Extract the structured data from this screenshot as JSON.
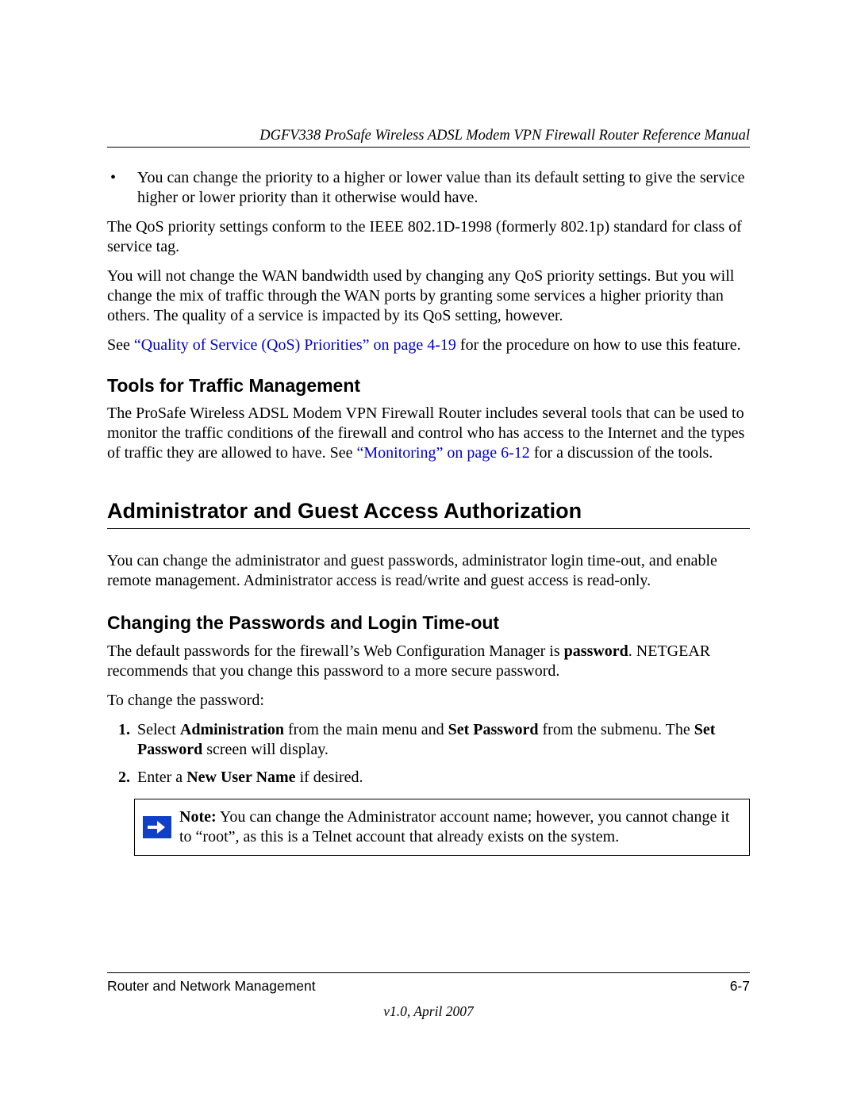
{
  "header": {
    "running_title": "DGFV338 ProSafe Wireless ADSL Modem VPN Firewall Router Reference Manual"
  },
  "content": {
    "bullet1": "You can change the priority to a higher or lower value than its default setting to give the service higher or lower priority than it otherwise would have.",
    "p1": "The QoS priority settings conform to the IEEE 802.1D-1998 (formerly 802.1p) standard for class of service tag.",
    "p2": "You will not change the WAN bandwidth used by changing any QoS priority settings. But you will change the mix of traffic through the WAN ports by granting some services a higher priority than others. The quality of a service is impacted by its QoS setting, however.",
    "p3_pre": "See ",
    "p3_link": "“Quality of Service (QoS) Priorities” on page 4-19",
    "p3_post": " for the procedure on how to use this feature.",
    "h3_tools": "Tools for Traffic Management",
    "p4_pre": "The ProSafe Wireless ADSL Modem VPN Firewall Router includes several tools that can be used to monitor the traffic conditions of the firewall and control who has access to the Internet and the types of traffic they are allowed to have. See ",
    "p4_link": "“Monitoring” on page 6-12",
    "p4_post": " for a discussion of the tools.",
    "h2_admin": "Administrator and Guest Access Authorization",
    "p5": "You can change the administrator and guest passwords, administrator login time-out, and enable remote management. Administrator access is read/write and guest access is read-only.",
    "h3_pass": "Changing the Passwords and Login Time-out",
    "p6_pre": "The default passwords for the firewall’s Web Configuration Manager is ",
    "p6_bold": "password",
    "p6_post": ". NETGEAR recommends that you change this password to a more secure password.",
    "p7": "To change the password:",
    "step1_a": "Select ",
    "step1_b": "Administration",
    "step1_c": " from the main menu and ",
    "step1_d": "Set Password",
    "step1_e": " from the submenu. The ",
    "step1_f": "Set Password",
    "step1_g": " screen will display.",
    "step2_a": "Enter a ",
    "step2_b": "New User Name",
    "step2_c": " if desired.",
    "note_label": "Note:",
    "note_body": " You can change the Administrator account name; however, you cannot change it to “root”, as this is a Telnet account that already exists on the system."
  },
  "footer": {
    "left": "Router and Network Management",
    "right": "6-7",
    "version": "v1.0, April 2007"
  }
}
